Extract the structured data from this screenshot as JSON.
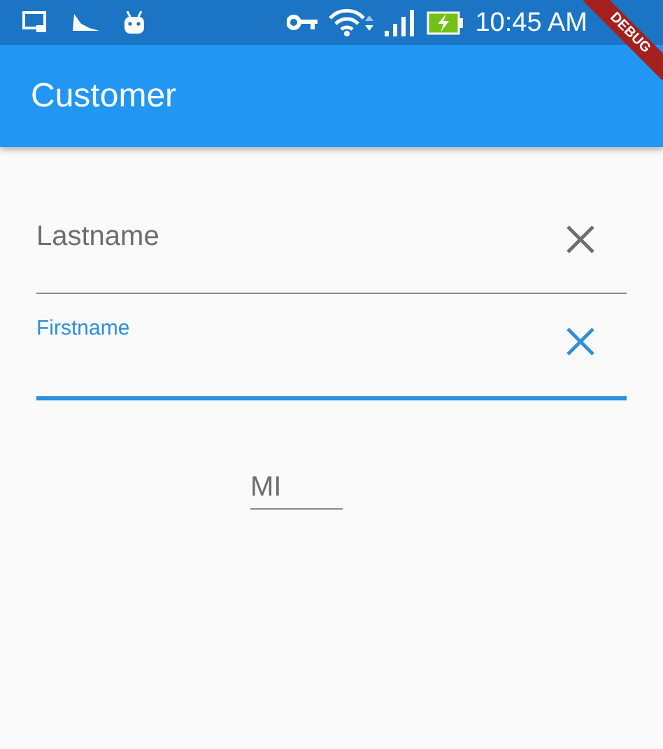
{
  "status_bar": {
    "time": "10:45 AM"
  },
  "app_bar": {
    "title": "Customer"
  },
  "debug_banner": "DEBUG",
  "fields": [
    {
      "label": "Lastname",
      "focused": false,
      "kind": "clearable"
    },
    {
      "label": "Firstname",
      "focused": true,
      "kind": "clearable"
    },
    {
      "label": "MI",
      "focused": false,
      "kind": "short"
    }
  ]
}
